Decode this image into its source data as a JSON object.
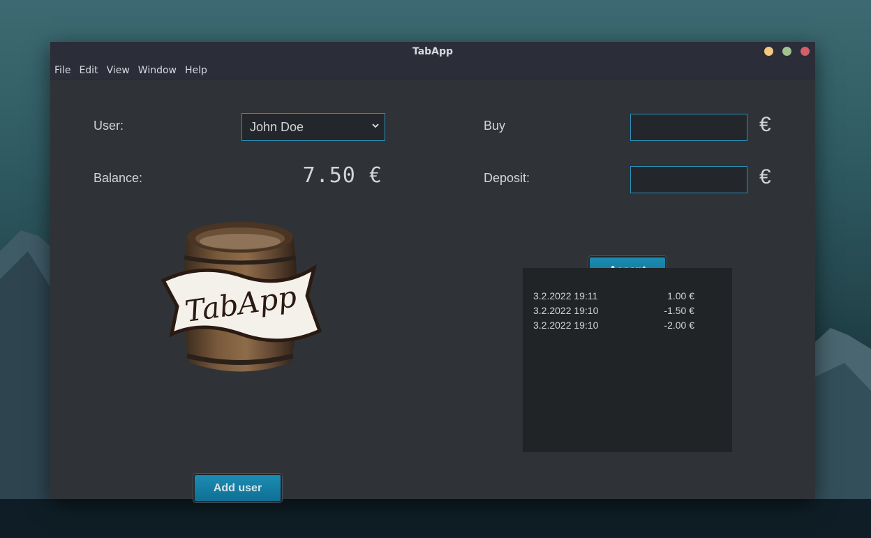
{
  "window": {
    "title": "TabApp",
    "controls": {
      "minimize_color": "#f2c97d",
      "maximize_color": "#a0c48f",
      "close_color": "#d1606a"
    }
  },
  "menu": [
    {
      "label": "File"
    },
    {
      "label": "Edit"
    },
    {
      "label": "View"
    },
    {
      "label": "Window"
    },
    {
      "label": "Help"
    }
  ],
  "user": {
    "label": "User:",
    "selected": "John Doe"
  },
  "balance": {
    "label": "Balance:",
    "value": "7.50 €"
  },
  "buy": {
    "label": "Buy",
    "value": "",
    "currency": "€"
  },
  "deposit": {
    "label": "Deposit:",
    "value": "",
    "currency": "€"
  },
  "accept_button": "Accept",
  "add_user_button": "Add user",
  "logo_text": "TabApp",
  "transactions": [
    {
      "date": "3.2.2022 19:11",
      "amount": "1.00 €"
    },
    {
      "date": "3.2.2022 19:10",
      "amount": "-1.50 €"
    },
    {
      "date": "3.2.2022 19:10",
      "amount": "-2.00 €"
    }
  ],
  "colors": {
    "accent": "#1c8cb3",
    "field_border": "#2a90b8",
    "window_bg": "#2f3337"
  }
}
